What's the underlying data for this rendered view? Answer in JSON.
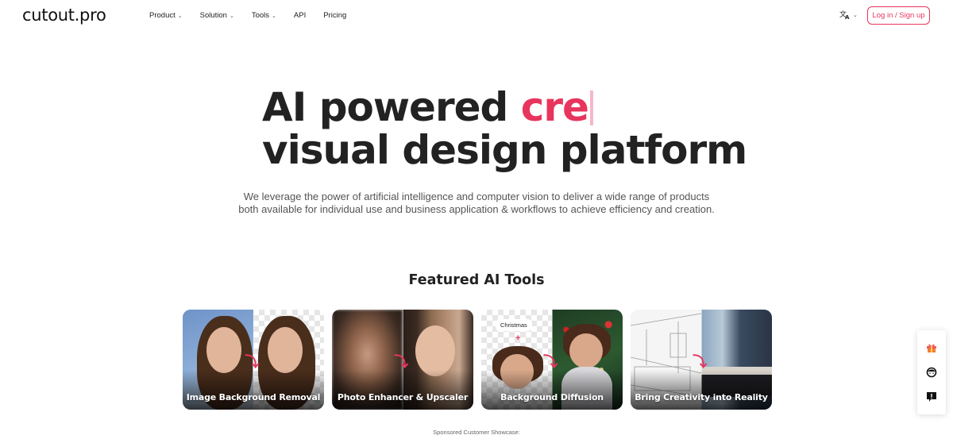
{
  "header": {
    "logo": "cutout.pro",
    "nav": [
      {
        "label": "Product",
        "has_dropdown": true
      },
      {
        "label": "Solution",
        "has_dropdown": true
      },
      {
        "label": "Tools",
        "has_dropdown": true
      },
      {
        "label": "API",
        "has_dropdown": false
      },
      {
        "label": "Pricing",
        "has_dropdown": false
      }
    ],
    "language_icon": "translate-icon",
    "login_label": "Log in / Sign up"
  },
  "hero": {
    "title_line1_prefix": "AI powered ",
    "title_line1_typed": "cre",
    "title_line2": "visual design platform",
    "description": "We leverage the power of artificial intelligence and computer vision to deliver a wide range of products both available for individual use and business application & workflows to achieve efficiency and creation."
  },
  "featured": {
    "title": "Featured AI Tools",
    "cards": [
      {
        "label": "Image Background Removal"
      },
      {
        "label": "Photo Enhancer & Upscaler"
      },
      {
        "label": "Background Diffusion",
        "chip": "Christmas",
        "plus": "+"
      },
      {
        "label": "Bring Creativity into Reality"
      }
    ]
  },
  "side_toolbar": {
    "icons": [
      "gift-icon",
      "support-agent-icon",
      "feedback-icon"
    ]
  },
  "footer_note": "Sponsored Customer Showcase:",
  "colors": {
    "accent": "#e8355d",
    "cursor": "#f6b7c6",
    "text_dark": "#222222",
    "text_muted": "#555555"
  }
}
